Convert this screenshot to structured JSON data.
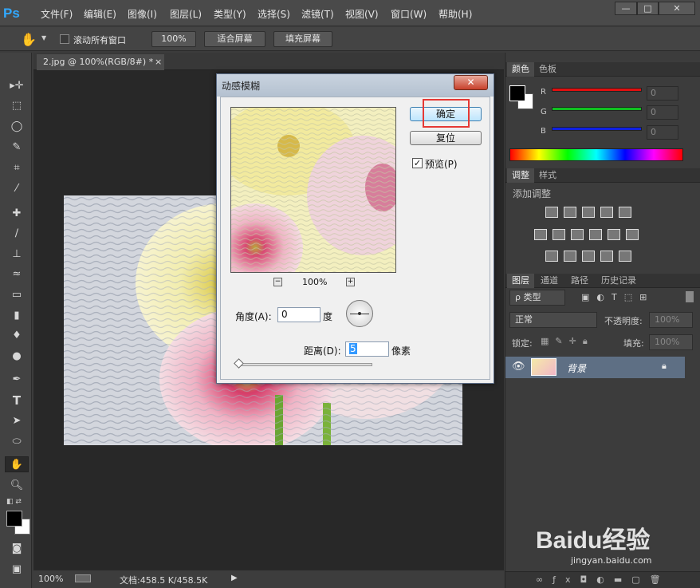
{
  "app": {
    "logo": "Ps"
  },
  "menus": [
    "文件(F)",
    "编辑(E)",
    "图像(I)",
    "图层(L)",
    "类型(Y)",
    "选择(S)",
    "滤镜(T)",
    "视图(V)",
    "窗口(W)",
    "帮助(H)"
  ],
  "window_controls": {
    "minimize": "—",
    "maximize": "□",
    "close": "✕"
  },
  "options_bar": {
    "scroll_all_label": "滚动所有窗口",
    "zoom_btn": "100%",
    "fit_screen": "适合屏幕",
    "fill_screen": "填充屏幕"
  },
  "document": {
    "tab_title": "2.jpg @ 100%(RGB/8#) *",
    "tab_close": "×"
  },
  "status": {
    "zoom": "100%",
    "doc_size": "文档:458.5 K/458.5K"
  },
  "colors_panel": {
    "tabs": [
      "颜色",
      "色板"
    ],
    "channels": [
      {
        "label": "R",
        "value": "0",
        "color": "#e01010"
      },
      {
        "label": "G",
        "value": "0",
        "color": "#10c020"
      },
      {
        "label": "B",
        "value": "0",
        "color": "#1020e0"
      }
    ]
  },
  "adjust_panel": {
    "tabs": [
      "调整",
      "样式"
    ],
    "title": "添加调整"
  },
  "layers_panel": {
    "tabs": [
      "图层",
      "通道",
      "路径",
      "历史记录"
    ],
    "kind_filter": "ρ 类型",
    "blend_mode": "正常",
    "opacity_label": "不透明度:",
    "opacity_value": "100%",
    "lock_label": "锁定:",
    "fill_label": "填充:",
    "fill_value": "100%",
    "layers": [
      {
        "name": "背景",
        "visible": true,
        "locked": true
      }
    ]
  },
  "dialog": {
    "title": "动感模糊",
    "close": "✕",
    "ok": "确定",
    "reset": "复位",
    "preview_label": "预览(P)",
    "preview_checked": true,
    "zoom_value": "100%",
    "zoom_out": "−",
    "zoom_in": "+",
    "angle_label": "角度(A):",
    "angle_value": "0",
    "angle_unit": "度",
    "distance_label": "距离(D):",
    "distance_value": "5",
    "distance_unit": "像素"
  },
  "watermark": {
    "brand": "Baidu经验",
    "url": "jingyan.baidu.com"
  },
  "highlight_color": "#e53935"
}
